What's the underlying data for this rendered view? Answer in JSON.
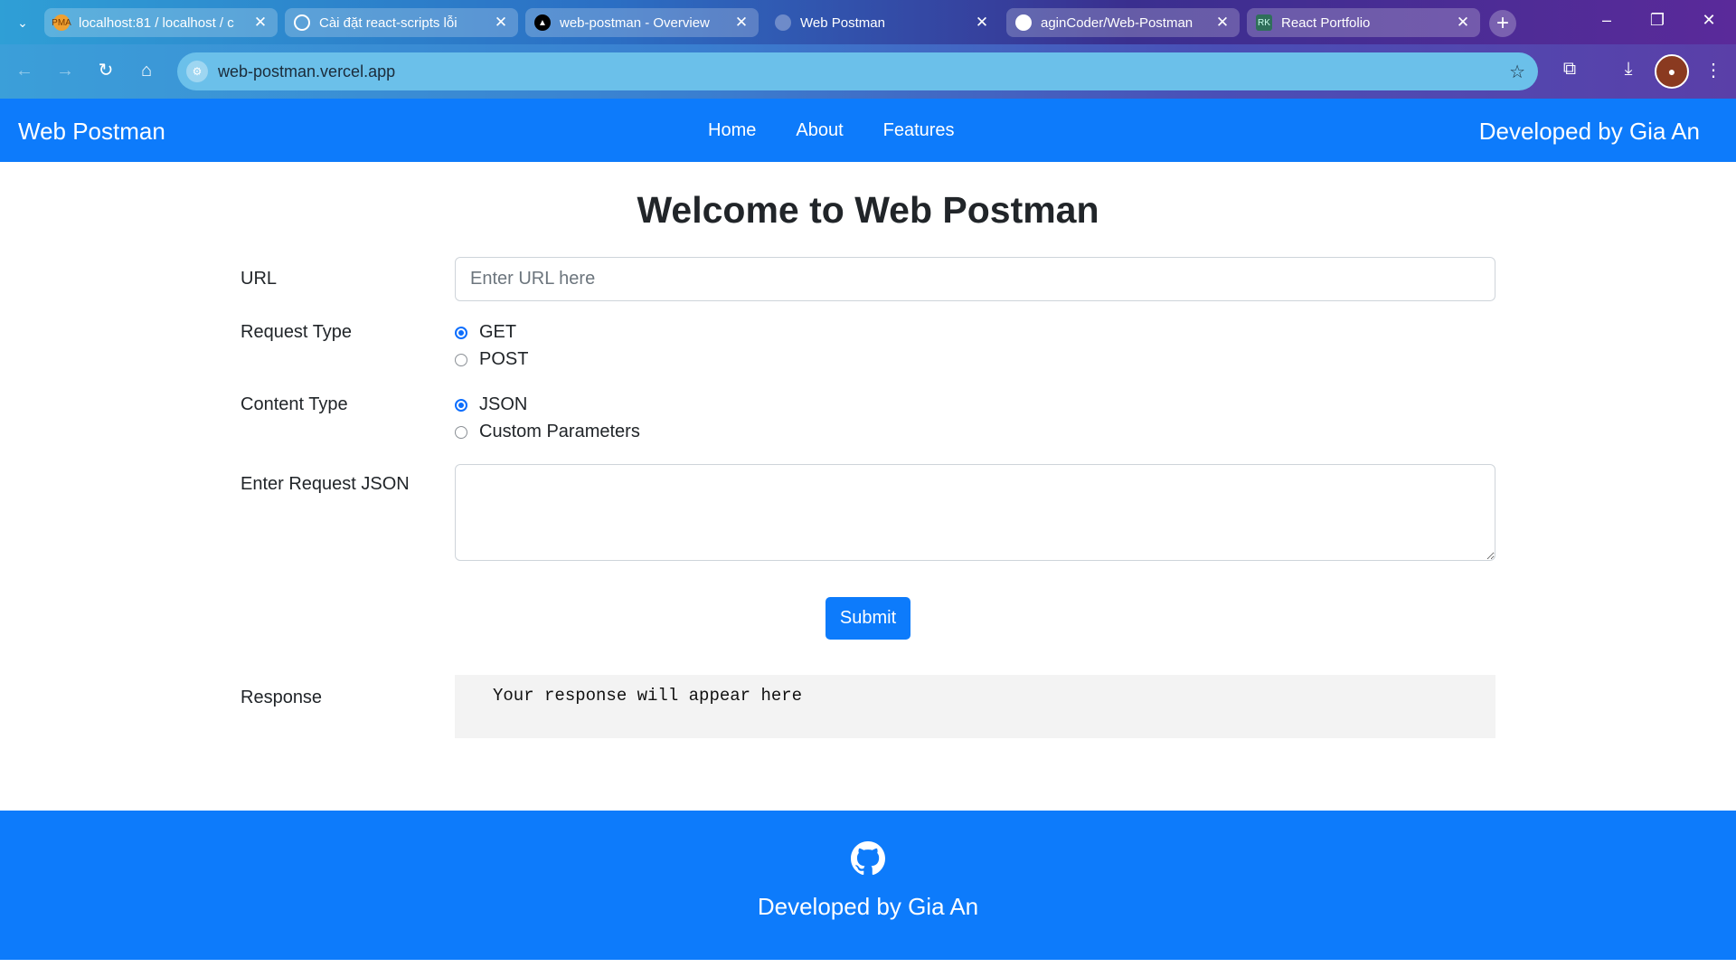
{
  "browser": {
    "tabs": [
      {
        "title": "localhost:81 / localhost / c",
        "active": false
      },
      {
        "title": "Cài đặt react-scripts lỗi",
        "active": false
      },
      {
        "title": "web-postman - Overview",
        "active": false
      },
      {
        "title": "Web Postman",
        "active": true
      },
      {
        "title": "aginCoder/Web-Postman",
        "active": false
      },
      {
        "title": "React Portfolio",
        "active": false
      }
    ],
    "favicons": [
      "PMA",
      "",
      "▲",
      "",
      "",
      "RK"
    ],
    "address": "web-postman.vercel.app",
    "new_tab": "+"
  },
  "nav": {
    "brand": "Web Postman",
    "links": [
      "Home",
      "About",
      "Features"
    ],
    "developer": "Developed by Gia An"
  },
  "main": {
    "title": "Welcome to Web Postman",
    "url_label": "URL",
    "url_placeholder": "Enter URL here",
    "url_value": "",
    "request_type_label": "Request Type",
    "request_types": [
      {
        "label": "GET",
        "checked": true
      },
      {
        "label": "POST",
        "checked": false
      }
    ],
    "content_type_label": "Content Type",
    "content_types": [
      {
        "label": "JSON",
        "checked": true
      },
      {
        "label": "Custom Parameters",
        "checked": false
      }
    ],
    "json_label": "Enter Request JSON",
    "json_value": "",
    "submit": "Submit",
    "response_label": "Response",
    "response_text": "Your response will appear here"
  },
  "footer": {
    "text": "Developed by Gia An"
  },
  "colors": {
    "primary": "#0d7bfb",
    "response_bg": "#f3f3f3"
  }
}
